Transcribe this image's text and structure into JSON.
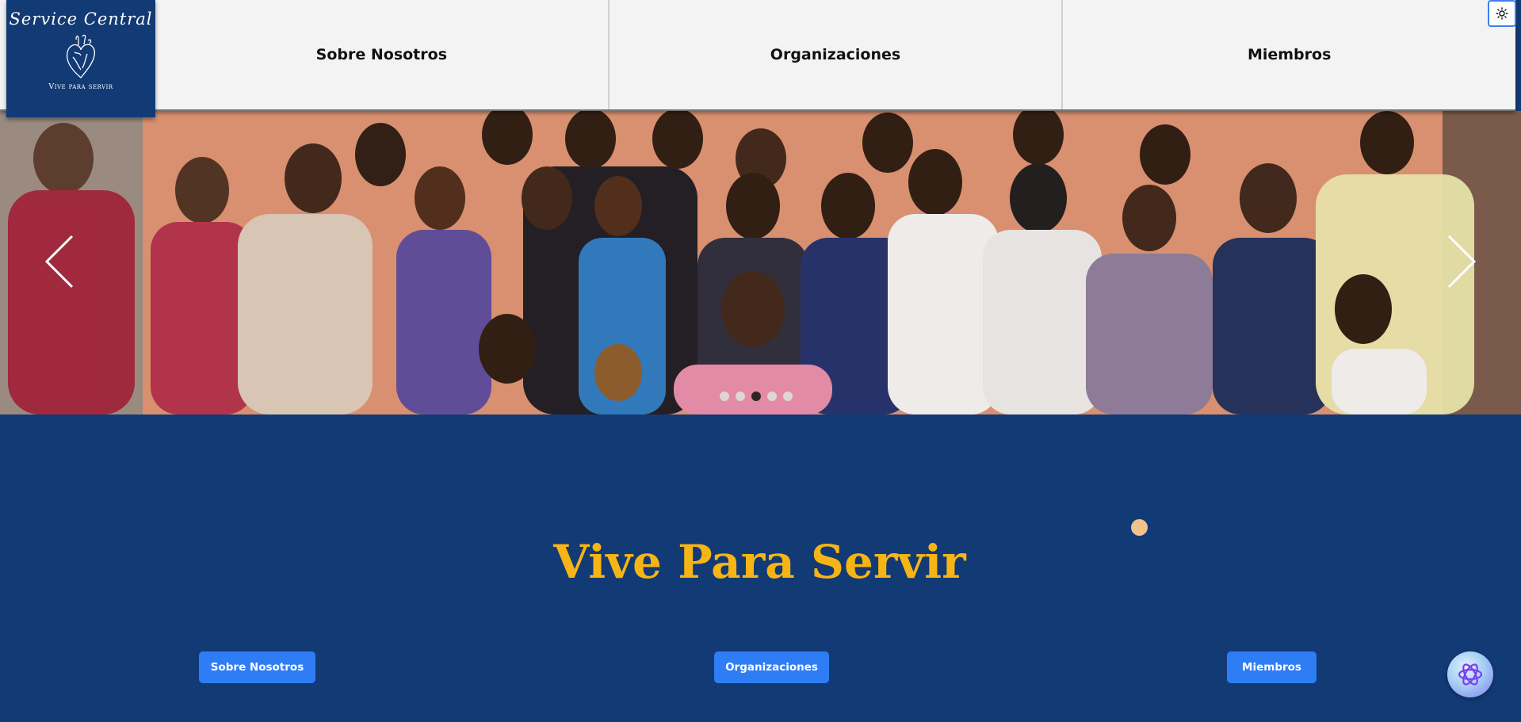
{
  "logo": {
    "title": "Service Central",
    "subtitle": "Vive para servir"
  },
  "nav": {
    "items": [
      "Sobre Nosotros",
      "Organizaciones",
      "Miembros"
    ]
  },
  "carousel": {
    "slide_count": 5,
    "active_index": 2
  },
  "hero": {
    "title": "Vive Para Servir"
  },
  "buttons": {
    "sobre": "Sobre Nosotros",
    "organizaciones": "Organizaciones",
    "miembros": "Miembros"
  },
  "colors": {
    "primary": "#123a75",
    "accent": "#f7b515",
    "button": "#2f7df5"
  },
  "icons": {
    "theme_toggle": "sun-icon",
    "chat": "chatgpt-icon"
  }
}
